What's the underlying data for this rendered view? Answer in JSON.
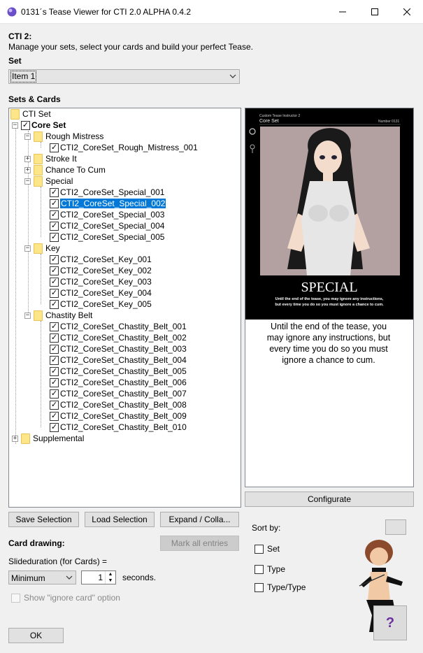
{
  "window": {
    "title": "0131´s Tease Viewer for CTI 2.0 ALPHA 0.4.2"
  },
  "header": {
    "title": "CTI 2:",
    "subtitle": "Manage your sets, select your cards and build your perfect Tease."
  },
  "set": {
    "label": "Set",
    "value": "Item 1"
  },
  "sets_cards": {
    "label": "Sets & Cards",
    "tree": [
      {
        "label": "CTI Set",
        "level": 0
      },
      {
        "label": "Core Set",
        "level": 0
      },
      {
        "label": "Rough Mistress",
        "level": 1
      },
      {
        "label": "CTI2_CoreSet_Rough_Mistress_001",
        "level": 2
      },
      {
        "label": "Stroke It",
        "level": 1
      },
      {
        "label": "Chance To Cum",
        "level": 1
      },
      {
        "label": "Special",
        "level": 1
      },
      {
        "label": "CTI2_CoreSet_Special_001",
        "level": 2
      },
      {
        "label": "CTI2_CoreSet_Special_002",
        "level": 2
      },
      {
        "label": "CTI2_CoreSet_Special_003",
        "level": 2
      },
      {
        "label": "CTI2_CoreSet_Special_004",
        "level": 2
      },
      {
        "label": "CTI2_CoreSet_Special_005",
        "level": 2
      },
      {
        "label": "Key",
        "level": 1
      },
      {
        "label": "CTI2_CoreSet_Key_001",
        "level": 2
      },
      {
        "label": "CTI2_CoreSet_Key_002",
        "level": 2
      },
      {
        "label": "CTI2_CoreSet_Key_003",
        "level": 2
      },
      {
        "label": "CTI2_CoreSet_Key_004",
        "level": 2
      },
      {
        "label": "CTI2_CoreSet_Key_005",
        "level": 2
      },
      {
        "label": "Chastity Belt",
        "level": 1
      },
      {
        "label": "CTI2_CoreSet_Chastity_Belt_001",
        "level": 2
      },
      {
        "label": "CTI2_CoreSet_Chastity_Belt_002",
        "level": 2
      },
      {
        "label": "CTI2_CoreSet_Chastity_Belt_003",
        "level": 2
      },
      {
        "label": "CTI2_CoreSet_Chastity_Belt_004",
        "level": 2
      },
      {
        "label": "CTI2_CoreSet_Chastity_Belt_005",
        "level": 2
      },
      {
        "label": "CTI2_CoreSet_Chastity_Belt_006",
        "level": 2
      },
      {
        "label": "CTI2_CoreSet_Chastity_Belt_007",
        "level": 2
      },
      {
        "label": "CTI2_CoreSet_Chastity_Belt_008",
        "level": 2
      },
      {
        "label": "CTI2_CoreSet_Chastity_Belt_009",
        "level": 2
      },
      {
        "label": "CTI2_CoreSet_Chastity_Belt_010",
        "level": 2
      },
      {
        "label": "Supplemental",
        "level": 0
      }
    ],
    "selected": "CTI2_CoreSet_Special_002"
  },
  "card": {
    "header_small": "Custom Tease Instructor 2",
    "header_set": "Core Set",
    "number": "Number 0131",
    "name": "SPECIAL",
    "image_text_1": "Until the end of the tease, you may ignore any instructions,",
    "image_text_2": "but every time you do so you must ignore a chance to cum.",
    "description": "Until the end of the tease, you may ignore any instructions, but every time you do so you must ignore a chance to cum."
  },
  "buttons": {
    "configurate": "Configurate",
    "save_selection": "Save Selection",
    "load_selection": "Load Selection",
    "expand_collapse": "Expand / Colla...",
    "mark_all": "Mark all entries",
    "ok": "OK"
  },
  "card_drawing": {
    "label": "Card drawing:",
    "slideduration_label": "Slideduration (for Cards) =",
    "duration_mode": "Minimum",
    "duration_value": "1",
    "seconds_label": "seconds.",
    "ignore_option_label": "Show \"ignore card\" option"
  },
  "sort": {
    "label": "Sort by:",
    "options": [
      "Set",
      "Type",
      "Type/Type"
    ]
  },
  "help": {
    "glyph": "?"
  },
  "colors": {
    "selection": "#0078d7",
    "card_bg": "#b3a1a1"
  }
}
